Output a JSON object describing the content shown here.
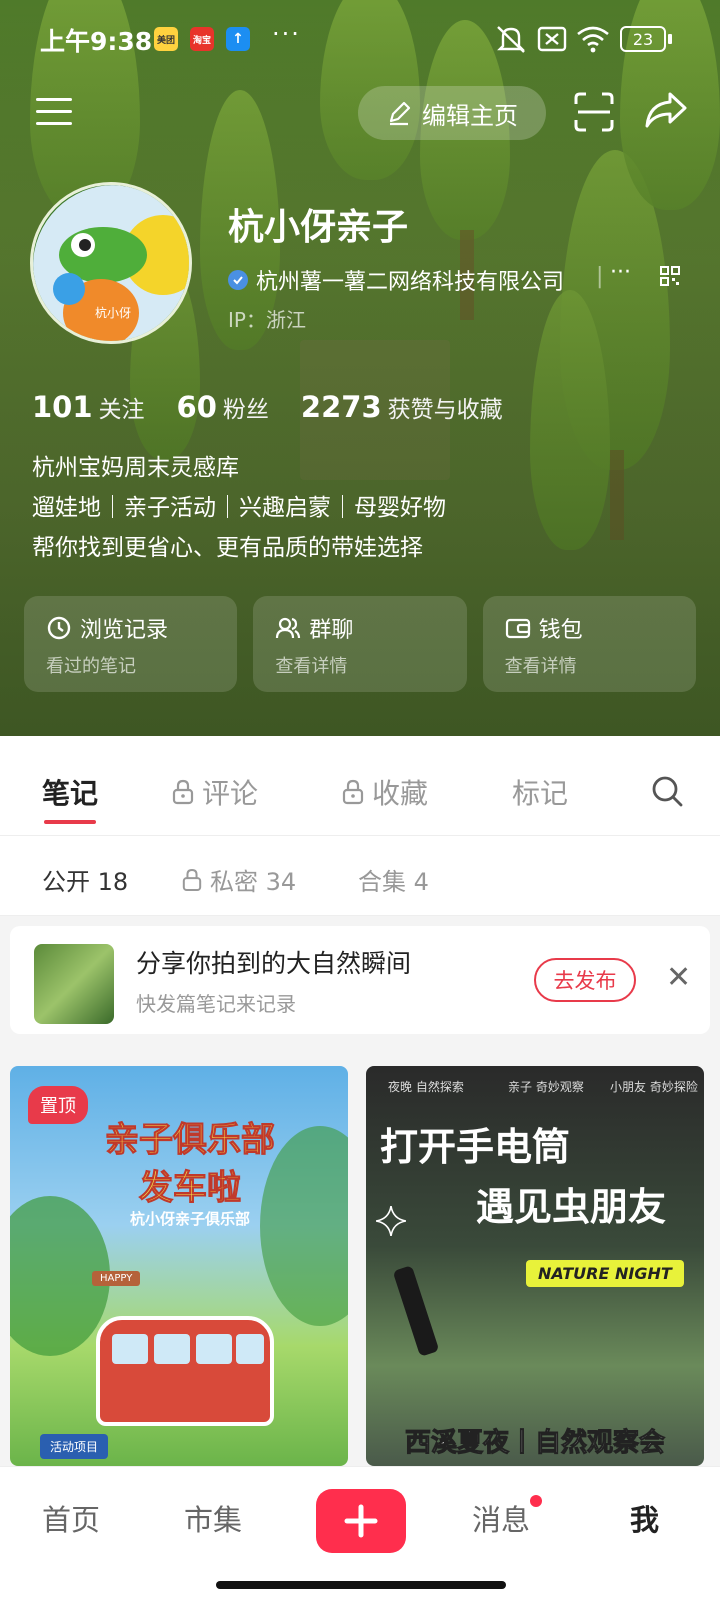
{
  "status_bar": {
    "time": "上午9:38",
    "apps": [
      "美团",
      "淘宝",
      "↑"
    ],
    "more": "···",
    "battery": "23"
  },
  "topbar": {
    "edit_label": "编辑主页"
  },
  "profile": {
    "name": "杭小伢亲子",
    "company": "杭州薯一薯二网络科技有限公司",
    "more": "···",
    "ip": "IP：浙江",
    "avatar_text": "杭小伢"
  },
  "stats": [
    {
      "value": "101",
      "label": "关注"
    },
    {
      "value": "60",
      "label": "粉丝"
    },
    {
      "value": "2273",
      "label": "获赞与收藏"
    }
  ],
  "bio": [
    "杭州宝妈周末灵感库",
    "遛娃地｜亲子活动｜兴趣启蒙｜母婴好物",
    "帮你找到更省心、更有品质的带娃选择"
  ],
  "cards": [
    {
      "title": "浏览记录",
      "sub": "看过的笔记",
      "icon": "clock-icon"
    },
    {
      "title": "群聊",
      "sub": "查看详情",
      "icon": "group-icon"
    },
    {
      "title": "钱包",
      "sub": "查看详情",
      "icon": "wallet-icon"
    }
  ],
  "tabs": [
    {
      "label": "笔记",
      "active": true,
      "locked": false
    },
    {
      "label": "评论",
      "active": false,
      "locked": true
    },
    {
      "label": "收藏",
      "active": false,
      "locked": true
    },
    {
      "label": "标记",
      "active": false,
      "locked": false
    }
  ],
  "subtabs": [
    {
      "label": "公开 18",
      "locked": false
    },
    {
      "label": "私密 34",
      "locked": true
    },
    {
      "label": "合集 4",
      "locked": false
    }
  ],
  "prompt": {
    "title": "分享你拍到的大自然瞬间",
    "subtitle": "快发篇笔记来记录",
    "button": "去发布",
    "close": "✕"
  },
  "notes": [
    {
      "pinned_label": "置顶",
      "title_line1": "亲子俱乐部",
      "title_line2": "发车啦",
      "subtitle": "杭小伢亲子俱乐部",
      "sign": "HAPPY",
      "bottom_label": "活动项目"
    },
    {
      "tags": [
        "夜晚 自然探索",
        "亲子 奇妙观察",
        "小朋友 奇妙探险"
      ],
      "title_line1": "打开手电筒",
      "title_line2": "遇见虫朋友",
      "banner": "NATURE NIGHT",
      "bottom_title": "西溪夏夜丨自然观察会"
    }
  ],
  "bottom_nav": [
    {
      "label": "首页",
      "active": false
    },
    {
      "label": "市集",
      "active": false
    },
    {
      "label": "消息",
      "active": false
    },
    {
      "label": "我",
      "active": true
    }
  ],
  "colors": {
    "accent": "#e83a4a",
    "plus": "#ff2e4d",
    "hero": "#5b7634"
  }
}
